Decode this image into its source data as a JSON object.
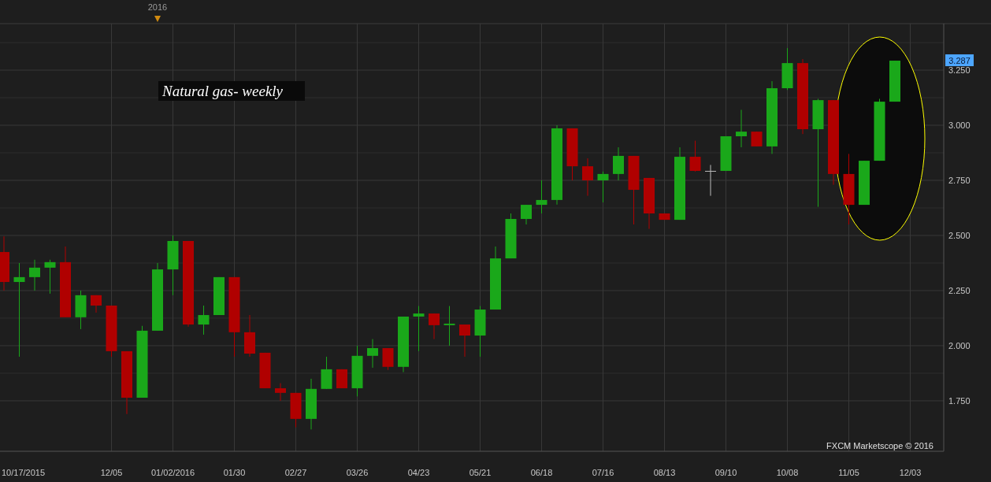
{
  "year_marker": {
    "label": "2016"
  },
  "chart": {
    "start_date_label": "10/17/2015",
    "credit": "FXCM Marketscope © 2016",
    "price_tag": {
      "label": "3.287"
    },
    "chart_data": {
      "type": "candlestick",
      "title": "Natural gas- weekly",
      "grid": true,
      "ylim": [
        1.521,
        3.461
      ],
      "categories": [
        null,
        null,
        null,
        null,
        null,
        null,
        null,
        "12/05",
        null,
        null,
        null,
        "01/02/2016",
        null,
        null,
        null,
        "01/30",
        null,
        null,
        null,
        "02/27",
        null,
        null,
        null,
        "03/26",
        null,
        null,
        null,
        "04/23",
        null,
        null,
        null,
        "05/21",
        null,
        null,
        null,
        "06/18",
        null,
        null,
        null,
        "07/16",
        null,
        null,
        null,
        "08/13",
        null,
        null,
        null,
        "09/10",
        null,
        null,
        null,
        "10/08",
        null,
        null,
        null,
        "11/05",
        null,
        null,
        null,
        "12/03"
      ],
      "yticks": [
        {
          "value": 1.75,
          "label": "1.750"
        },
        {
          "value": 2.0,
          "label": "2.000"
        },
        {
          "value": 2.25,
          "label": "2.250"
        },
        {
          "value": 2.5,
          "label": "2.500"
        },
        {
          "value": 2.75,
          "label": "2.750"
        },
        {
          "value": 3.0,
          "label": "3.000"
        },
        {
          "value": 3.25,
          "label": "3.250"
        }
      ],
      "ohlc": [
        [
          2.425,
          2.496,
          2.25,
          2.289
        ],
        [
          2.289,
          2.375,
          1.95,
          2.311
        ],
        [
          2.311,
          2.39,
          2.25,
          2.354
        ],
        [
          2.354,
          2.39,
          2.236,
          2.379
        ],
        [
          2.379,
          2.45,
          2.129,
          2.129
        ],
        [
          2.129,
          2.25,
          2.075,
          2.229
        ],
        [
          2.229,
          2.229,
          2.15,
          2.182
        ],
        [
          2.182,
          2.182,
          1.95,
          1.975
        ],
        [
          1.975,
          1.975,
          1.69,
          1.764
        ],
        [
          1.764,
          2.09,
          1.764,
          2.068
        ],
        [
          2.068,
          2.375,
          2.068,
          2.346
        ],
        [
          2.346,
          2.5,
          2.229,
          2.475
        ],
        [
          2.475,
          2.475,
          2.086,
          2.096
        ],
        [
          2.096,
          2.182,
          2.05,
          2.139
        ],
        [
          2.139,
          2.311,
          2.139,
          2.311
        ],
        [
          2.311,
          2.311,
          1.95,
          2.061
        ],
        [
          2.061,
          2.139,
          1.95,
          1.964
        ],
        [
          1.968,
          1.968,
          1.807,
          1.807
        ],
        [
          1.807,
          1.83,
          1.75,
          1.786
        ],
        [
          1.786,
          1.786,
          1.63,
          1.668
        ],
        [
          1.668,
          1.85,
          1.62,
          1.804
        ],
        [
          1.804,
          1.95,
          1.804,
          1.893
        ],
        [
          1.893,
          1.893,
          1.807,
          1.807
        ],
        [
          1.807,
          2.0,
          1.77,
          1.954
        ],
        [
          1.954,
          2.03,
          1.9,
          1.989
        ],
        [
          1.989,
          1.989,
          1.89,
          1.904
        ],
        [
          1.904,
          2.132,
          1.88,
          2.132
        ],
        [
          2.132,
          2.18,
          1.975,
          2.146
        ],
        [
          2.146,
          2.146,
          2.03,
          2.093
        ],
        [
          2.093,
          2.18,
          2.0,
          2.1
        ],
        [
          2.096,
          2.096,
          1.95,
          2.046
        ],
        [
          2.046,
          2.18,
          1.95,
          2.164
        ],
        [
          2.164,
          2.45,
          2.164,
          2.396
        ],
        [
          2.396,
          2.6,
          2.396,
          2.575
        ],
        [
          2.575,
          2.639,
          2.55,
          2.639
        ],
        [
          2.639,
          2.75,
          2.6,
          2.661
        ],
        [
          2.661,
          3.0,
          2.64,
          2.986
        ],
        [
          2.986,
          2.986,
          2.75,
          2.814
        ],
        [
          2.814,
          2.85,
          2.68,
          2.75
        ],
        [
          2.75,
          2.79,
          2.65,
          2.779
        ],
        [
          2.779,
          2.9,
          2.75,
          2.861
        ],
        [
          2.861,
          2.861,
          2.55,
          2.707
        ],
        [
          2.761,
          2.761,
          2.53,
          2.6
        ],
        [
          2.6,
          2.6,
          2.571,
          2.571
        ],
        [
          2.571,
          2.9,
          2.571,
          2.857
        ],
        [
          2.857,
          2.93,
          2.79,
          2.793
        ],
        [
          2.793,
          2.82,
          2.68,
          2.793
        ],
        [
          2.793,
          2.95,
          2.793,
          2.95
        ],
        [
          2.95,
          3.07,
          2.9,
          2.971
        ],
        [
          2.971,
          2.971,
          2.904,
          2.904
        ],
        [
          2.904,
          3.2,
          2.87,
          3.168
        ],
        [
          3.168,
          3.35,
          3.16,
          3.282
        ],
        [
          3.282,
          3.3,
          2.96,
          2.982
        ],
        [
          2.982,
          3.12,
          2.63,
          3.114
        ],
        [
          3.114,
          3.114,
          2.73,
          2.779
        ],
        [
          2.779,
          2.87,
          2.55,
          2.639
        ],
        [
          2.639,
          2.839,
          2.639,
          2.839
        ],
        [
          2.839,
          3.12,
          2.839,
          3.107
        ],
        [
          3.107,
          3.293,
          3.107,
          3.293
        ],
        null
      ]
    }
  }
}
